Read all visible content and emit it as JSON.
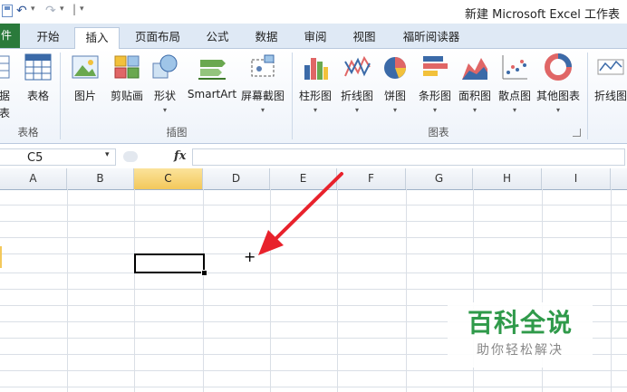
{
  "window": {
    "title": "新建 Microsoft Excel 工作表"
  },
  "quick_access": {
    "more_glyph": "▾",
    "separator": "|"
  },
  "tabs": [
    {
      "label": "开始"
    },
    {
      "label": "插入"
    },
    {
      "label": "页面布局"
    },
    {
      "label": "公式"
    },
    {
      "label": "数据"
    },
    {
      "label": "审阅"
    },
    {
      "label": "视图"
    },
    {
      "label": "福昕阅读器"
    }
  ],
  "file_tab": {
    "label": "件"
  },
  "ribbon": {
    "tables_group": {
      "label": "表格",
      "partial_button": "据",
      "partial_button_2": "表",
      "table_button": "表格"
    },
    "illustrations_group": {
      "label": "插图",
      "buttons": [
        {
          "label": "图片"
        },
        {
          "label": "剪贴画"
        },
        {
          "label": "形状"
        },
        {
          "label": "SmartArt"
        },
        {
          "label": "屏幕截图"
        }
      ]
    },
    "charts_group": {
      "label": "图表",
      "buttons": [
        {
          "label": "柱形图"
        },
        {
          "label": "折线图"
        },
        {
          "label": "饼图"
        },
        {
          "label": "条形图"
        },
        {
          "label": "面积图"
        },
        {
          "label": "散点图"
        },
        {
          "label": "其他图表"
        }
      ]
    },
    "sparklines_group": {
      "partial_button": "折线图"
    },
    "dropdown_glyph": "▾"
  },
  "formula_bar": {
    "name_box": "C5",
    "fx_label": "fx",
    "formula": ""
  },
  "grid": {
    "columns": [
      "A",
      "B",
      "C",
      "D",
      "E",
      "F",
      "G",
      "H",
      "I"
    ],
    "selected_column": "C",
    "selected_cell": "C5",
    "cursor": "+"
  },
  "colors": {
    "file_tab": "#2a7a3b",
    "selection": "#000000",
    "arrow": "#e8222c",
    "watermark": "#2f9a4a"
  },
  "watermark": {
    "title": "百科全说",
    "subtitle": "助你轻松解决"
  }
}
